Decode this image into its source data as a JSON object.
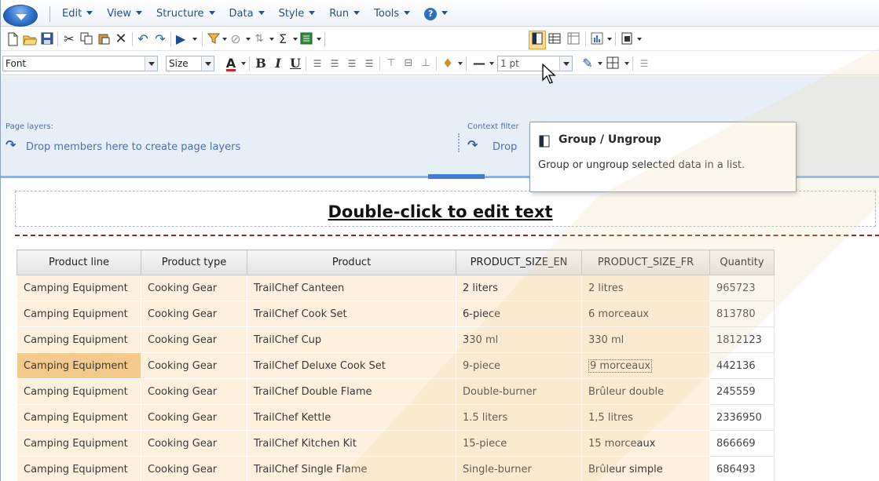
{
  "menu": {
    "items": [
      {
        "label": "Edit"
      },
      {
        "label": "View"
      },
      {
        "label": "Structure"
      },
      {
        "label": "Data"
      },
      {
        "label": "Style"
      },
      {
        "label": "Run"
      },
      {
        "label": "Tools"
      }
    ]
  },
  "toolbar_format": {
    "font_value": "Font",
    "size_value": "Size",
    "line_width_value": "1 pt"
  },
  "layers": {
    "page_layers_title": "Page layers:",
    "page_layers_hint": "Drop members here to create page layers",
    "context_filter_title": "Context filter",
    "context_filter_hint": "Drop"
  },
  "tooltip": {
    "title": "Group / Ungroup",
    "body": "Group or ungroup selected data in a list.",
    "icon": "group-ungroup-icon"
  },
  "report": {
    "header_text": "Double-click to edit text",
    "columns": [
      "Product line",
      "Product type",
      "Product",
      "PRODUCT_SIZE_EN",
      "PRODUCT_SIZE_FR",
      "Quantity"
    ],
    "rows": [
      [
        "Camping Equipment",
        "Cooking Gear",
        "TrailChef Canteen",
        "2 liters",
        "2 litres",
        "965723"
      ],
      [
        "Camping Equipment",
        "Cooking Gear",
        "TrailChef Cook Set",
        "6-piece",
        "6 morceaux",
        "813780"
      ],
      [
        "Camping Equipment",
        "Cooking Gear",
        "TrailChef Cup",
        "330 ml",
        "330 ml",
        "1812123"
      ],
      [
        "Camping Equipment",
        "Cooking Gear",
        "TrailChef Deluxe Cook Set",
        "9-piece",
        "9 morceaux",
        "442136"
      ],
      [
        "Camping Equipment",
        "Cooking Gear",
        "TrailChef Double Flame",
        "Double-burner",
        "Brûleur double",
        "245559"
      ],
      [
        "Camping Equipment",
        "Cooking Gear",
        "TrailChef Kettle",
        "1.5 liters",
        "1,5 litres",
        "2336950"
      ],
      [
        "Camping Equipment",
        "Cooking Gear",
        "TrailChef Kitchen Kit",
        "15-piece",
        "15 morceaux",
        "866669"
      ],
      [
        "Camping Equipment",
        "Cooking Gear",
        "TrailChef Single Flame",
        "Single-burner",
        "Brûleur simple",
        "686493"
      ]
    ]
  },
  "colors": {
    "accent": "#2a4f86",
    "cell_bg": "#fdf0dc",
    "selected_cell": "#f3c98c",
    "active_tool": "#fbd98e"
  }
}
